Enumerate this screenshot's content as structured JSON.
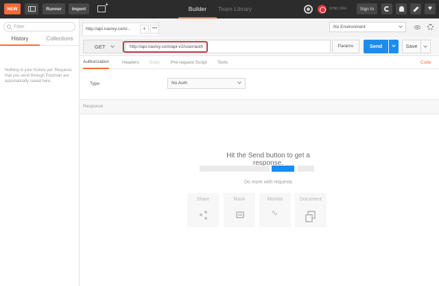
{
  "header": {
    "new_label": "NEW",
    "runner_label": "Runner",
    "import_label": "Import",
    "builder_label": "Builder",
    "team_library_label": "Team Library",
    "sync_label": "SYNC OFF",
    "sign_in_label": "Sign In",
    "accent": "#f26b3a"
  },
  "sidebar": {
    "filter_placeholder": "Filter",
    "tabs": [
      {
        "label": "History"
      },
      {
        "label": "Collections"
      }
    ],
    "empty_message": "Nothing in your history yet. Requests that you send through Postman are automatically saved here."
  },
  "request_tab": {
    "title": "http://api.navixy.com/...",
    "add_label": "+",
    "more_label": "•••"
  },
  "environment": {
    "selected": "No Environment"
  },
  "request": {
    "method": "GET",
    "url": "http://api.navixy.com/api-v2/user/auth",
    "params_label": "Params",
    "send_label": "Send",
    "send_color": "#1b8cf0",
    "save_label": "Save"
  },
  "request_tabs": [
    {
      "label": "Authorization"
    },
    {
      "label": "Headers"
    },
    {
      "label": "Body"
    },
    {
      "label": "Pre-request Script"
    },
    {
      "label": "Tests"
    }
  ],
  "code_label": "Code",
  "authorization": {
    "type_label": "Type",
    "type_value": "No Auth"
  },
  "response": {
    "header_label": "Response",
    "hit_send": "Hit the Send button to get a response.",
    "do_more": "Do more with requests",
    "cards": [
      {
        "label": "Share",
        "icon": "share-icon"
      },
      {
        "label": "Mock",
        "icon": "mock-icon"
      },
      {
        "label": "Monitor",
        "icon": "monitor-icon"
      },
      {
        "label": "Document",
        "icon": "document-icon"
      }
    ]
  }
}
